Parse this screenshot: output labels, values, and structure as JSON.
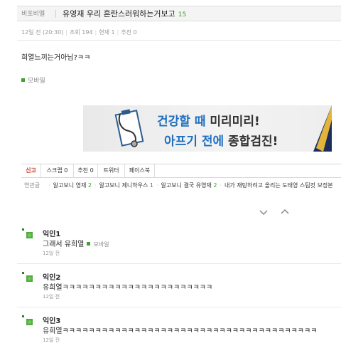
{
  "post": {
    "board": "비포비엘",
    "title": "유영재 우리 혼란스러워하는거보고",
    "comment_count": "15",
    "meta": {
      "time": "12일 전 (20:30)",
      "views": "조회 194",
      "recommend_now": "현재 1",
      "recommend": "추천 0"
    },
    "body": "희열느끼는거아님?ㅋㅋ",
    "source": "모바일"
  },
  "banner": {
    "line1_blue": "건강할 때",
    "line1_dark": " 미리미리!",
    "line2_blue": "아프기 전에",
    "line2_dark": " 종합검진!"
  },
  "tabs": [
    {
      "label": "신고",
      "count": ""
    },
    {
      "label": "스크랩",
      "count": "0"
    },
    {
      "label": "추천",
      "count": "0"
    },
    {
      "label": "트위터",
      "count": ""
    },
    {
      "label": "페이스북",
      "count": ""
    }
  ],
  "related": {
    "label": "연관글",
    "items": [
      {
        "title": "알고보니 영재",
        "count": "2"
      },
      {
        "title": "알고보니 제니하우스",
        "count": "1"
      },
      {
        "title": "알고보니 결국 유영재",
        "count": "2"
      },
      {
        "title": "내가 재탕하려고 올리는 도태영 스팀컷 보정본",
        "count": ""
      }
    ]
  },
  "nav_icons": [
    "chevron-down-icon",
    "chevron-up-icon"
  ],
  "comments": [
    {
      "name": "익인1",
      "text": "그래서 유희열",
      "source": "모바일",
      "time": "12일 전"
    },
    {
      "name": "익인2",
      "text": "유희열ㅋㅋㅋㅋㅋㅋㅋㅋㅋㅋㅋㅋㅋㅋㅋㅋㅋㅋㅋㅋㅋㅋㅋ",
      "source": "",
      "time": "12일 전"
    },
    {
      "name": "익인3",
      "text": "유희열ㅋㅋㅋㅋㅋㅋㅋㅋㅋㅋㅋㅋㅋㅋㅋㅋㅋㅋㅋㅋㅋㅋㅋㅋㅋㅋㅋㅋㅋㅋㅋㅋㅋㅋㅋㅋㅋㅋㅋ",
      "source": "",
      "time": "12일 전"
    }
  ],
  "colors": {
    "accent_green": "#3da32a",
    "banner_blue": "#1f6fbf",
    "report_red": "#c0392b"
  }
}
